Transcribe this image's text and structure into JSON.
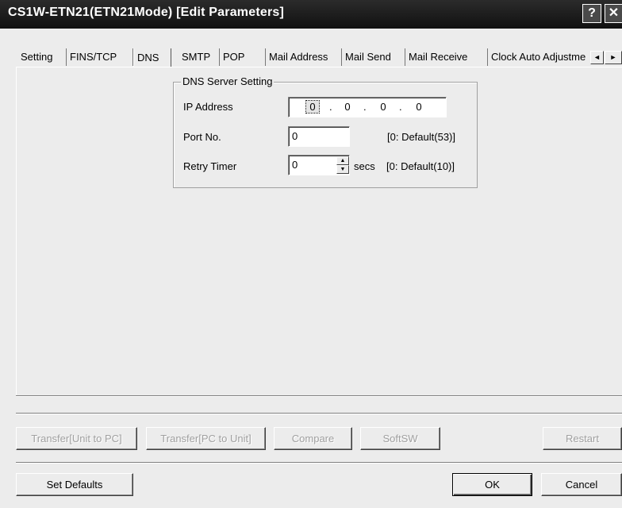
{
  "window": {
    "title": "CS1W-ETN21(ETN21Mode) [Edit Parameters]",
    "help_label": "?",
    "close_label": "✕"
  },
  "tabs": [
    {
      "label": "Setting"
    },
    {
      "label": "FINS/TCP"
    },
    {
      "label": "DNS",
      "active": true
    },
    {
      "label": "SMTP"
    },
    {
      "label": "POP"
    },
    {
      "label": "Mail Address"
    },
    {
      "label": "Mail Send"
    },
    {
      "label": "Mail Receive"
    },
    {
      "label": "Clock Auto Adjustme"
    }
  ],
  "tab_scroll": {
    "left": "◄",
    "right": "►"
  },
  "dns": {
    "group_title": "DNS Server Setting",
    "ip_label": "IP Address",
    "ip_octets": [
      "0",
      "0",
      "0",
      "0"
    ],
    "ip_separator": ".",
    "port_label": "Port No.",
    "port_value": "0",
    "port_hint": "[0: Default(53)]",
    "retry_label": "Retry Timer",
    "retry_value": "0",
    "retry_unit": "secs",
    "retry_hint": "[0: Default(10)]",
    "spin_up": "▲",
    "spin_down": "▼"
  },
  "buttons": {
    "transfer_unit_to_pc": "Transfer[Unit to PC]",
    "transfer_pc_to_unit": "Transfer[PC to Unit]",
    "compare": "Compare",
    "softsw": "SoftSW",
    "restart": "Restart",
    "set_defaults": "Set Defaults",
    "ok": "OK",
    "cancel": "Cancel"
  }
}
